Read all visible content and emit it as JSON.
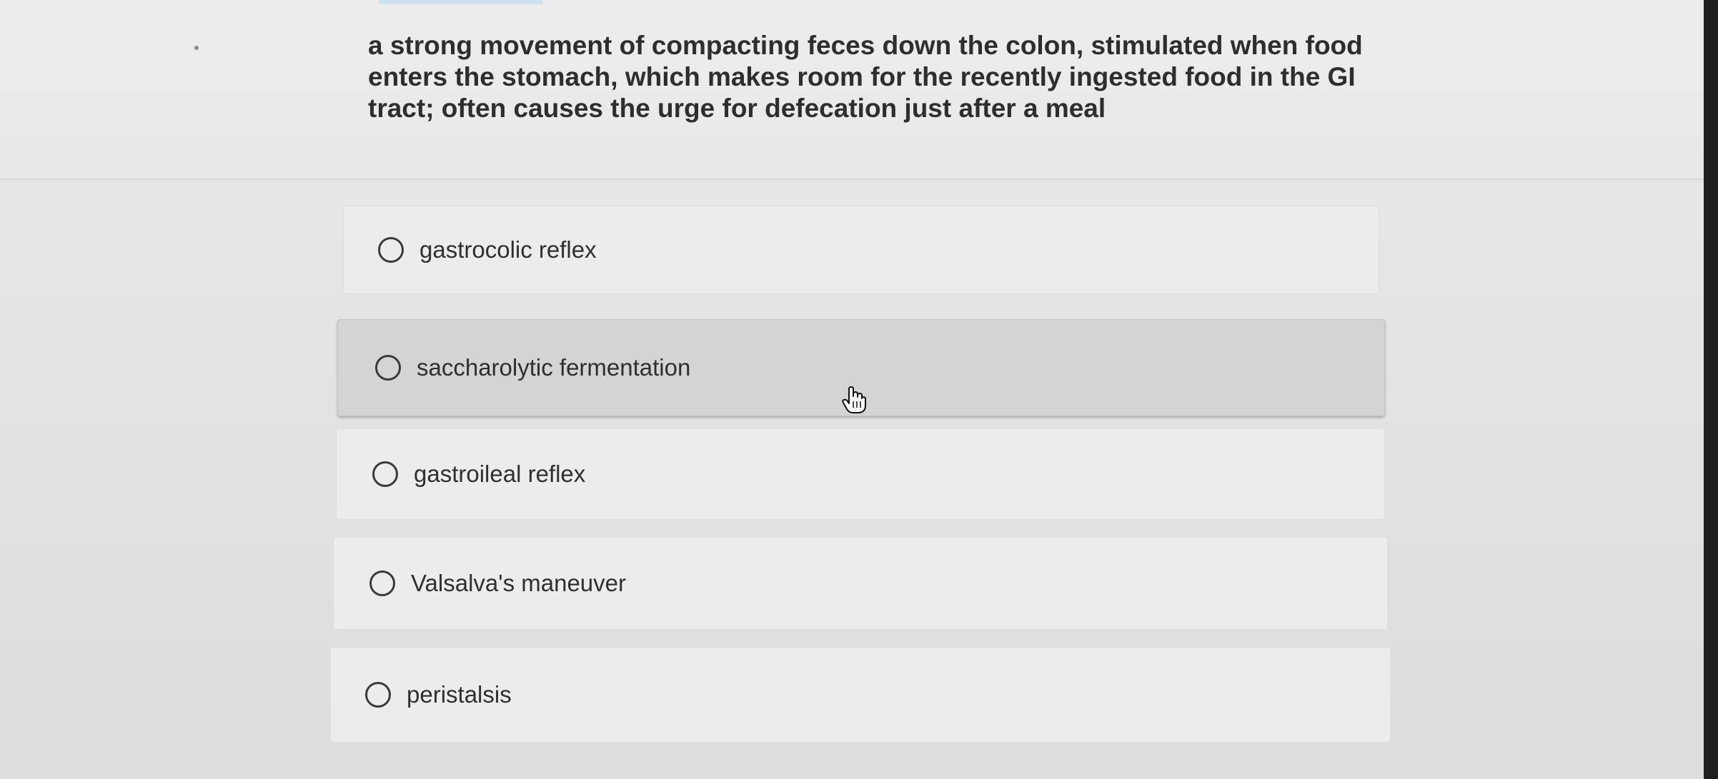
{
  "question": {
    "text": "a strong movement of compacting feces down the colon, stimulated when food enters the stomach, which makes room for the recently ingested food in the GI tract; often causes the urge for defecation just after a meal"
  },
  "options": [
    {
      "label": "gastrocolic reflex",
      "selected": false,
      "hovered": false
    },
    {
      "label": "saccharolytic fermentation",
      "selected": false,
      "hovered": true
    },
    {
      "label": "gastroileal reflex",
      "selected": false,
      "hovered": false
    },
    {
      "label": "Valsalva's maneuver",
      "selected": false,
      "hovered": false
    },
    {
      "label": "peristalsis",
      "selected": false,
      "hovered": false
    }
  ],
  "icons": {
    "radio": "radio-button-unchecked-icon",
    "cursor": "hand-pointer-cursor-icon"
  },
  "colors": {
    "background": "#e6e6e6",
    "option_background": "#ececec",
    "option_hover_background": "#d4d4d4",
    "text": "#2e2e2e"
  }
}
